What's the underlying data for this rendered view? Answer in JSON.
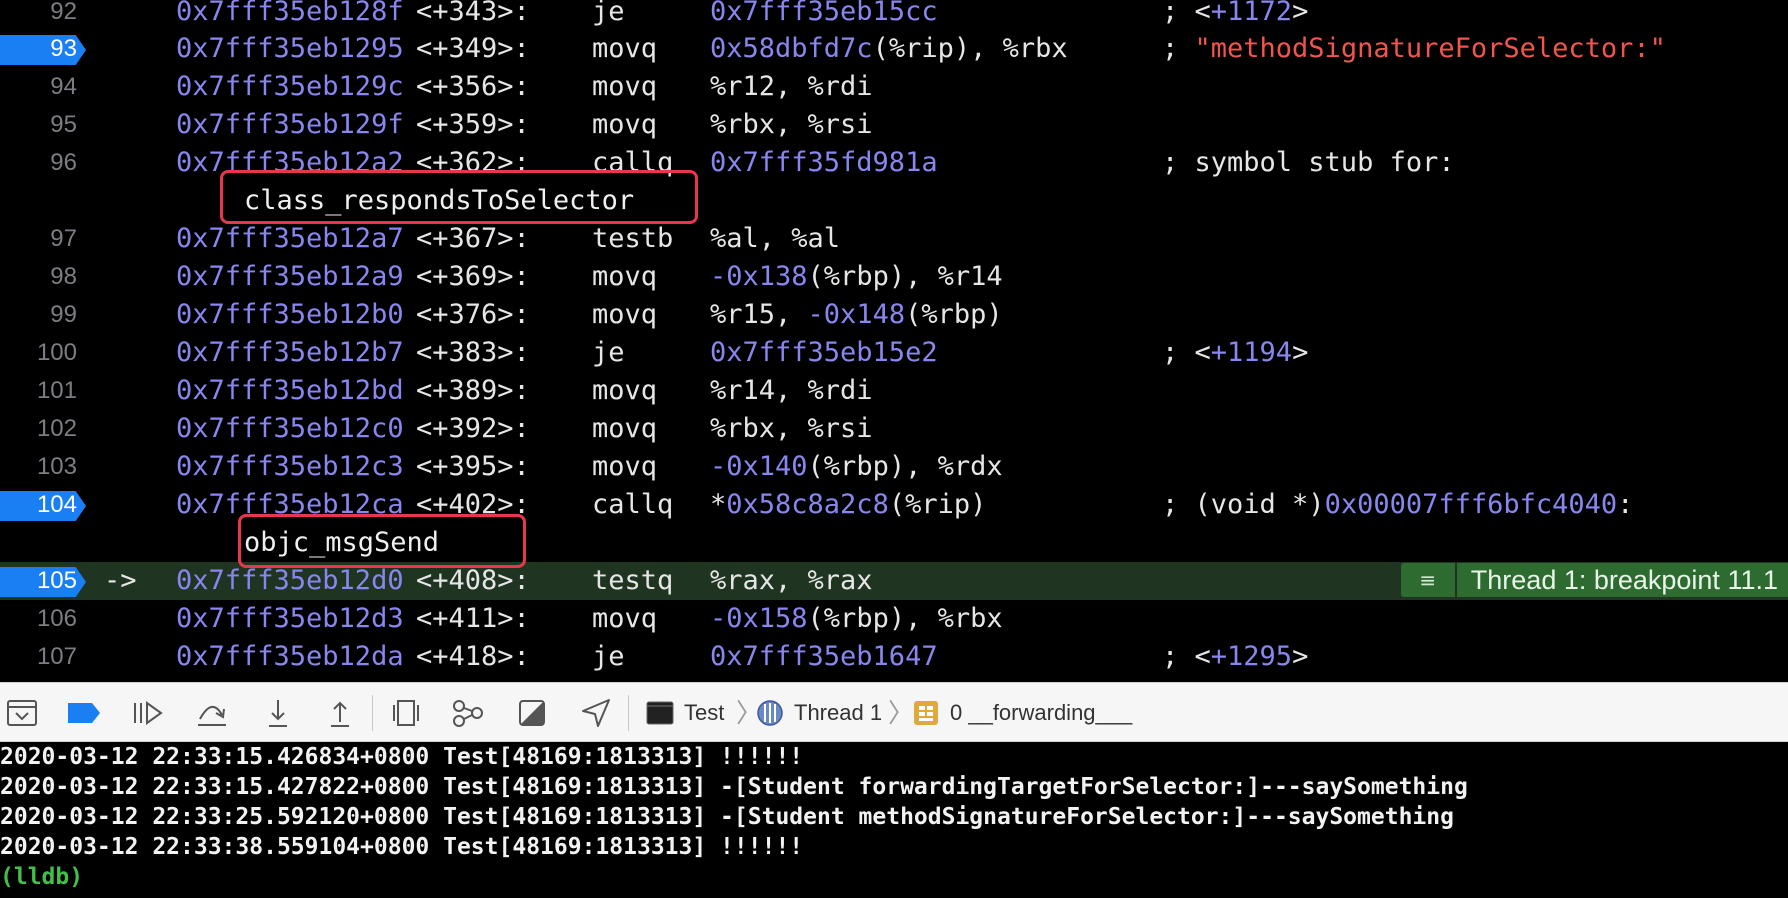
{
  "disassembly": {
    "rows": [
      {
        "line": "92",
        "addr": "0x7fff35eb128f",
        "off": "<+343>:",
        "mnem": "je",
        "op1": "",
        "op1num": "0x7fff35eb15cc",
        "op1rest": "",
        "c1": "; <",
        "cnum": "+1172",
        "c2": ">",
        "cstr": ""
      },
      {
        "line": "93",
        "addr": "0x7fff35eb1295",
        "off": "<+349>:",
        "mnem": "movq",
        "op1": "",
        "op1num": "0x58dbfd7c",
        "op1rest": "(%rip), %rbx",
        "c1": "; ",
        "cnum": "",
        "c2": "",
        "cstr": "\"methodSignatureForSelector:\""
      },
      {
        "line": "94",
        "addr": "0x7fff35eb129c",
        "off": "<+356>:",
        "mnem": "movq",
        "op1": "%r12, %rdi",
        "op1num": "",
        "op1rest": "",
        "c1": "",
        "cnum": "",
        "c2": "",
        "cstr": ""
      },
      {
        "line": "95",
        "addr": "0x7fff35eb129f",
        "off": "<+359>:",
        "mnem": "movq",
        "op1": "%rbx, %rsi",
        "op1num": "",
        "op1rest": "",
        "c1": "",
        "cnum": "",
        "c2": "",
        "cstr": ""
      },
      {
        "line": "96",
        "addr": "0x7fff35eb12a2",
        "off": "<+362>:",
        "mnem": "callq",
        "op1": "",
        "op1num": "0x7fff35fd981a",
        "op1rest": "",
        "c1": "; symbol stub for:",
        "cnum": "",
        "c2": "",
        "cstr": ""
      },
      {
        "line": "97",
        "addr": "0x7fff35eb12a7",
        "off": "<+367>:",
        "mnem": "testb",
        "op1": "%al, %al",
        "op1num": "",
        "op1rest": "",
        "c1": "",
        "cnum": "",
        "c2": "",
        "cstr": ""
      },
      {
        "line": "98",
        "addr": "0x7fff35eb12a9",
        "off": "<+369>:",
        "mnem": "movq",
        "op1": "",
        "op1num": "-0x138",
        "op1rest": "(%rbp), %r14",
        "c1": "",
        "cnum": "",
        "c2": "",
        "cstr": ""
      },
      {
        "line": "99",
        "addr": "0x7fff35eb12b0",
        "off": "<+376>:",
        "mnem": "movq",
        "op1": "%r15, ",
        "op1num": "-0x148",
        "op1rest": "(%rbp)",
        "c1": "",
        "cnum": "",
        "c2": "",
        "cstr": ""
      },
      {
        "line": "100",
        "addr": "0x7fff35eb12b7",
        "off": "<+383>:",
        "mnem": "je",
        "op1": "",
        "op1num": "0x7fff35eb15e2",
        "op1rest": "",
        "c1": "; <",
        "cnum": "+1194",
        "c2": ">",
        "cstr": ""
      },
      {
        "line": "101",
        "addr": "0x7fff35eb12bd",
        "off": "<+389>:",
        "mnem": "movq",
        "op1": "%r14, %rdi",
        "op1num": "",
        "op1rest": "",
        "c1": "",
        "cnum": "",
        "c2": "",
        "cstr": ""
      },
      {
        "line": "102",
        "addr": "0x7fff35eb12c0",
        "off": "<+392>:",
        "mnem": "movq",
        "op1": "%rbx, %rsi",
        "op1num": "",
        "op1rest": "",
        "c1": "",
        "cnum": "",
        "c2": "",
        "cstr": ""
      },
      {
        "line": "103",
        "addr": "0x7fff35eb12c3",
        "off": "<+395>:",
        "mnem": "movq",
        "op1": "",
        "op1num": "-0x140",
        "op1rest": "(%rbp), %rdx",
        "c1": "",
        "cnum": "",
        "c2": "",
        "cstr": ""
      },
      {
        "line": "104",
        "addr": "0x7fff35eb12ca",
        "off": "<+402>:",
        "mnem": "callq",
        "op1": "*",
        "op1num": "0x58c8a2c8",
        "op1rest": "(%rip)",
        "c1": "; (void *)",
        "cnum": "0x00007fff6bfc4040",
        "c2": ":",
        "cstr": ""
      },
      {
        "line": "105",
        "addr": "0x7fff35eb12d0",
        "off": "<+408>:",
        "mnem": "testq",
        "op1": "%rax, %rax",
        "op1num": "",
        "op1rest": "",
        "c1": "",
        "cnum": "",
        "c2": "",
        "cstr": ""
      },
      {
        "line": "106",
        "addr": "0x7fff35eb12d3",
        "off": "<+411>:",
        "mnem": "movq",
        "op1": "",
        "op1num": "-0x158",
        "op1rest": "(%rbp), %rbx",
        "c1": "",
        "cnum": "",
        "c2": "",
        "cstr": ""
      },
      {
        "line": "107",
        "addr": "0x7fff35eb12da",
        "off": "<+418>:",
        "mnem": "je",
        "op1": "",
        "op1num": "0x7fff35eb1647",
        "op1rest": "",
        "c1": "; <",
        "cnum": "+1295",
        "c2": ">",
        "cstr": ""
      }
    ],
    "cont_96": "class_respondsToSelector",
    "cont_104": "objc_msgSend",
    "pc_arrow": "->",
    "thread_badge": "Thread 1: breakpoint 11.1",
    "breakpoint_color": "#1a7ff3",
    "current_line_color": "#1f3522"
  },
  "debug_bar": {
    "process": "Test",
    "thread": "Thread 1",
    "frame": "0 __forwarding___"
  },
  "console": {
    "lines": [
      "2020-03-12 22:33:15.426834+0800 Test[48169:1813313] !!!!!!",
      "2020-03-12 22:33:15.427822+0800 Test[48169:1813313] -[Student forwardingTargetForSelector:]---saySomething",
      "2020-03-12 22:33:25.592120+0800 Test[48169:1813313] -[Student methodSignatureForSelector:]---saySomething",
      "2020-03-12 22:33:38.559104+0800 Test[48169:1813313] !!!!!!"
    ],
    "prompt": "(lldb)"
  }
}
